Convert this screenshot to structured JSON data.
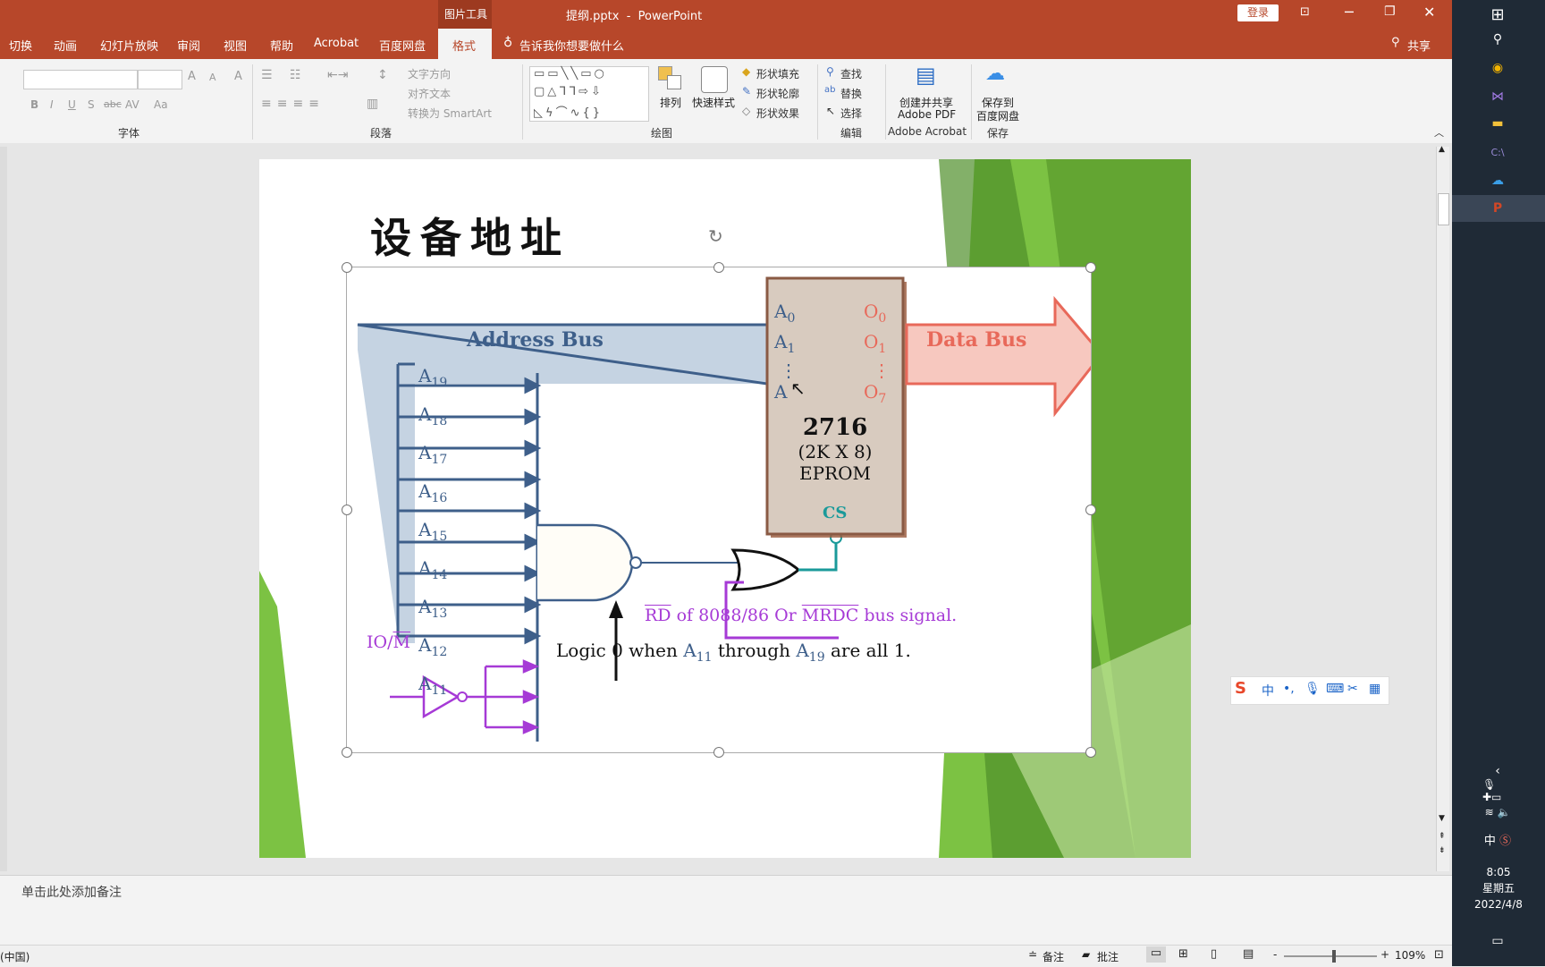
{
  "titlebar": {
    "context_tool": "图片工具",
    "doc_title": "提纲.pptx  -  PowerPoint",
    "login_label": "登录"
  },
  "tabs": [
    "切换",
    "动画",
    "幻灯片放映",
    "审阅",
    "视图",
    "帮助",
    "Acrobat",
    "百度网盘",
    "格式"
  ],
  "tell_me": "告诉我你想要做什么",
  "share_label": "共享",
  "ribbon": {
    "font_group": {
      "label": "字体",
      "bold": "B",
      "italic": "I",
      "underline": "U",
      "shadow": "S",
      "strike": "abc",
      "spacing": "AV",
      "case": "Aa",
      "grow": "A",
      "shrink": "A",
      "clear": "A"
    },
    "paragraph_group": {
      "label": "段落",
      "text_direction": "文字方向",
      "align_text": "对齐文本",
      "convert_smartart": "转换为 SmartArt"
    },
    "drawing_group": {
      "label": "绘图",
      "arrange": "排列",
      "quick_styles": "快速样式",
      "shape_fill": "形状填充",
      "shape_outline": "形状轮廓",
      "shape_effects": "形状效果"
    },
    "editing_group": {
      "label": "编辑",
      "find": "查找",
      "replace": "替换",
      "select": "选择"
    },
    "acrobat_group": {
      "label": "Adobe Acrobat",
      "create_pdf_line1": "创建并共享",
      "create_pdf_line2": "Adobe PDF"
    },
    "save_group": {
      "label": "保存",
      "save_baidu_line1": "保存到",
      "save_baidu_line2": "百度网盘"
    }
  },
  "slide": {
    "title": "设备地址",
    "diagram": {
      "address_bus": "Address Bus",
      "data_bus": "Data Bus",
      "address_lines": [
        {
          "base": "A",
          "sub": "19"
        },
        {
          "base": "A",
          "sub": "18"
        },
        {
          "base": "A",
          "sub": "17"
        },
        {
          "base": "A",
          "sub": "16"
        },
        {
          "base": "A",
          "sub": "15"
        },
        {
          "base": "A",
          "sub": "14"
        },
        {
          "base": "A",
          "sub": "13"
        },
        {
          "base": "A",
          "sub": "12"
        },
        {
          "base": "A",
          "sub": "11"
        }
      ],
      "chip_inputs": [
        {
          "base": "A",
          "sub": "0"
        },
        {
          "base": "A",
          "sub": "1"
        },
        {
          "base": "A",
          "sub": ""
        }
      ],
      "chip_outputs": [
        {
          "base": "O",
          "sub": "0"
        },
        {
          "base": "O",
          "sub": "1"
        },
        {
          "base": "O",
          "sub": "7"
        }
      ],
      "chip_dots": "⋮",
      "chip_name": "2716",
      "chip_org": "(2K X 8)",
      "chip_type": "EPROM",
      "chip_cs": "CS",
      "io_m_prefix": "IO/",
      "io_m_bar": "M",
      "rd_bar": "RD",
      "rd_mid": " of 8088/86 Or ",
      "mrdc_bar": "MRDC",
      "rd_end": " bus signal.",
      "logic_prefix": "Logic 0 when ",
      "logic_a11_base": "A",
      "logic_a11_sub": "11",
      "logic_mid": " through ",
      "logic_a19_base": "A",
      "logic_a19_sub": "19",
      "logic_end": " are all 1."
    }
  },
  "notes_placeholder": "单击此处添加备注",
  "status": {
    "left": "(中国)",
    "notes": "备注",
    "comments": "批注",
    "zoom": "109%",
    "zoom_minus": "-",
    "zoom_plus": "+"
  },
  "taskbar": {
    "time": "8:05",
    "day": "星期五",
    "date": "2022/4/8",
    "ime": "中"
  },
  "ime_bar": {
    "mode": "中",
    "punct": "•,"
  },
  "colors": {
    "accent": "#b7472a",
    "bus_blue": "#3e5f8a",
    "data_red": "#e8695a",
    "purple": "#a63ad6",
    "cs_teal": "#1a9a9a",
    "slide_green": "#7cc243"
  }
}
